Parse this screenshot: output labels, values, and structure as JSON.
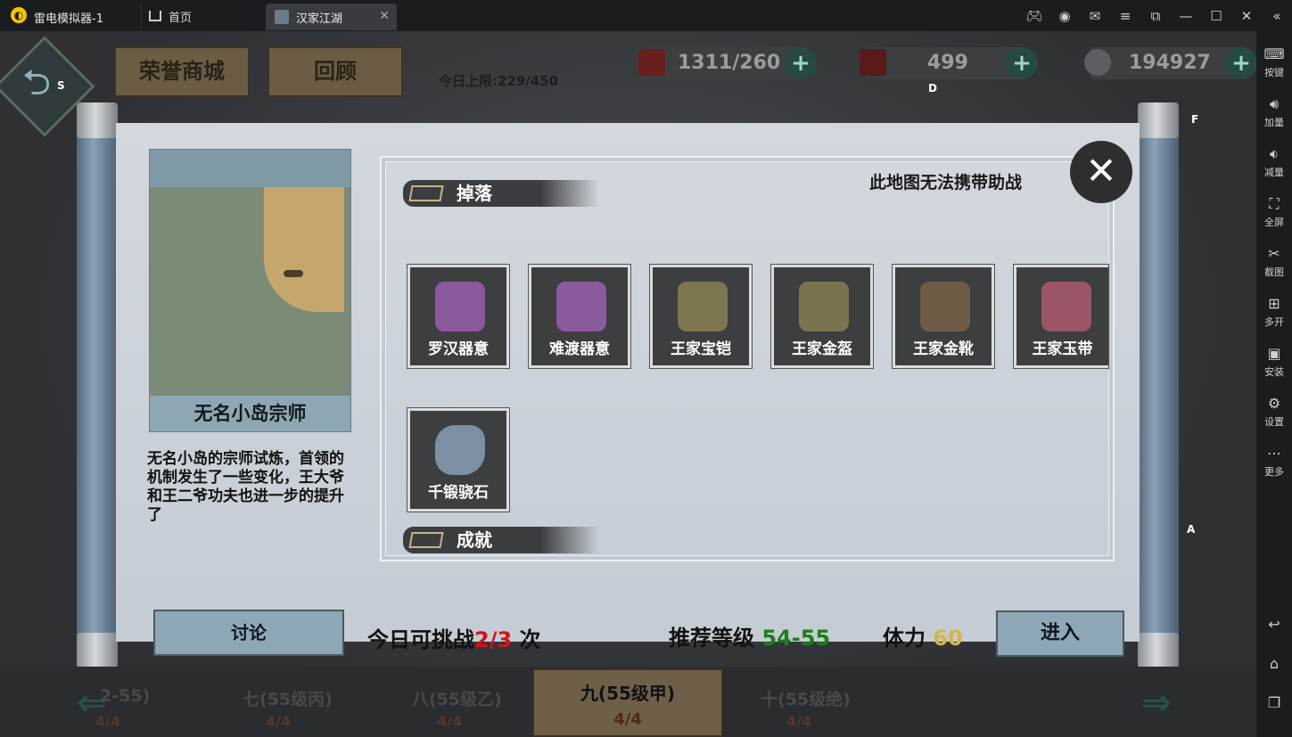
{
  "emulator": {
    "app_name": "雷电模拟器-1",
    "tabs": [
      {
        "label": "首页"
      },
      {
        "label": "汉家江湖"
      }
    ],
    "sidebar": [
      {
        "label": "按键",
        "icon": "keyboard-icon"
      },
      {
        "label": "加量",
        "icon": "volume-up-icon"
      },
      {
        "label": "减量",
        "icon": "volume-down-icon"
      },
      {
        "label": "全屏",
        "icon": "fullscreen-icon"
      },
      {
        "label": "截图",
        "icon": "scissors-icon"
      },
      {
        "label": "多开",
        "icon": "multi-instance-icon"
      },
      {
        "label": "安装",
        "icon": "apk-icon"
      },
      {
        "label": "设置",
        "icon": "gear-icon"
      },
      {
        "label": "更多",
        "icon": "more-icon"
      }
    ]
  },
  "game": {
    "top_buttons": {
      "honor_shop": "荣誉商城",
      "review": "回顾"
    },
    "daily_limit": "今日上限:229/450",
    "resources": {
      "stamina": "1311/260",
      "spirit": "499",
      "silver": "194927"
    },
    "keymap": {
      "back": "S",
      "spirit": "D",
      "f_key": "F",
      "a_key": "A"
    },
    "map": {
      "title": "无名小岛宗师"
    },
    "description": "无名小岛的宗师试炼，首领的机制发生了一些变化，王大爷和王二爷功夫也进一步的提升了",
    "drops_header": "掉落",
    "achievements_header": "成就",
    "no_helper": "此地图无法携带助战",
    "items": [
      {
        "name": "罗汉器意"
      },
      {
        "name": "难渡器意"
      },
      {
        "name": "王家宝铠"
      },
      {
        "name": "王家金盔"
      },
      {
        "name": "王家金靴"
      },
      {
        "name": "王家玉带"
      },
      {
        "name": "千锻骁石"
      }
    ],
    "discuss": "讨论",
    "challenge": {
      "prefix": "今日可挑战",
      "count": "2/3",
      "suffix": "次"
    },
    "recommend": {
      "label": "推荐等级",
      "value": "54-55"
    },
    "stamina_cost": {
      "label": "体力",
      "value": "60"
    },
    "enter": "进入",
    "levels": [
      {
        "label": "2-55)",
        "sub": "4/4"
      },
      {
        "label": "七(55级丙)",
        "sub": "4/4"
      },
      {
        "label": "八(55级乙)",
        "sub": "4/4"
      },
      {
        "label": "九(55级甲)",
        "sub": "4/4"
      },
      {
        "label": "十(55级绝)",
        "sub": "4/4"
      }
    ]
  }
}
